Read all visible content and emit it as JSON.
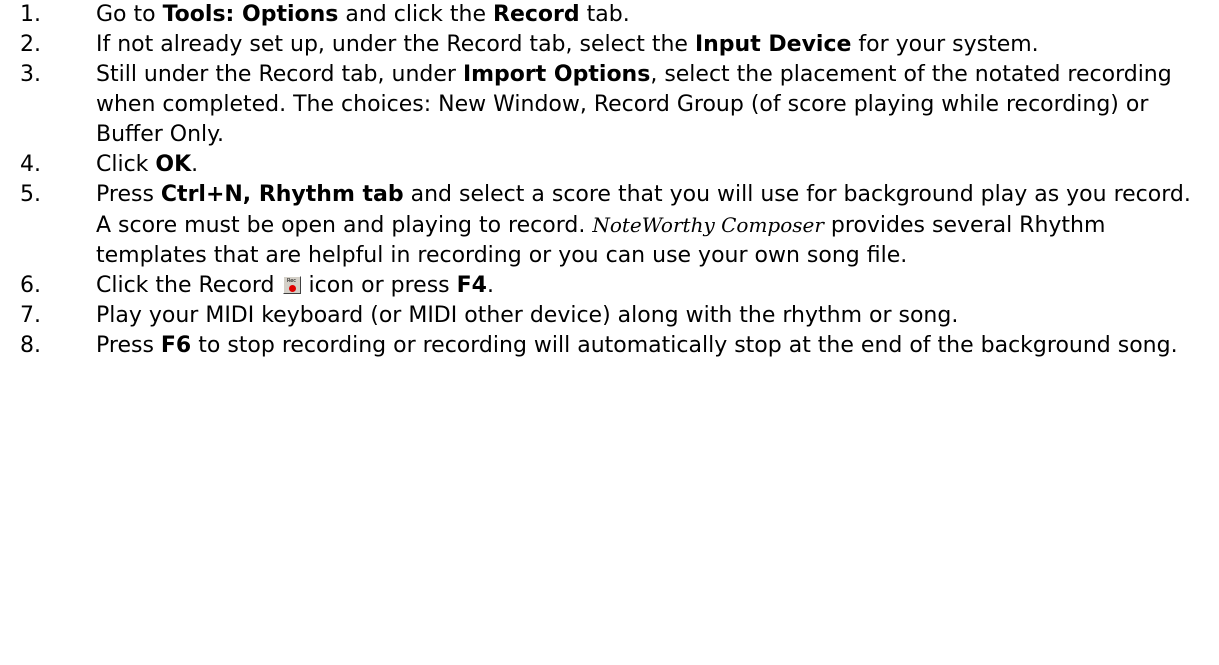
{
  "steps": [
    {
      "number": "1.",
      "parts": {
        "a": "Go to ",
        "b": "Tools: Options",
        "c": " and click the ",
        "d": "Record",
        "e": " tab."
      }
    },
    {
      "number": "2.",
      "parts": {
        "a": "If not already set up, under the Record tab, select the ",
        "b": "Input Device",
        "c": " for your system."
      }
    },
    {
      "number": "3.",
      "parts": {
        "a": "Still under the Record tab, under ",
        "b": "Import Options",
        "c": ", select the placement of the notated recording when completed. The choices: New Window, Record Group (of score playing while recording) or Buffer Only."
      }
    },
    {
      "number": "4.",
      "parts": {
        "a": "Click ",
        "b": "OK",
        "c": "."
      }
    },
    {
      "number": "5.",
      "parts": {
        "a": "Press ",
        "b": "Ctrl+N, Rhythm tab",
        "c": " and select a score that you will use for background play as you record. A score must be open and playing to record. ",
        "d": "NoteWorthy Composer",
        "e": " provides several Rhythm templates that are helpful in recording or you can use your own song file."
      }
    },
    {
      "number": "6.",
      "parts": {
        "a": "Click the Record",
        "icon_text": "Rec",
        "icon": "record-icon",
        "b": "icon or press ",
        "c": "F4",
        "d": "."
      }
    },
    {
      "number": "7.",
      "parts": {
        "a": "Play your MIDI keyboard (or MIDI other device) along with the rhythm or song."
      }
    },
    {
      "number": "8.",
      "parts": {
        "a": "Press ",
        "b": "F6",
        "c": " to stop recording or recording will automatically stop at the end of the background song."
      }
    }
  ]
}
